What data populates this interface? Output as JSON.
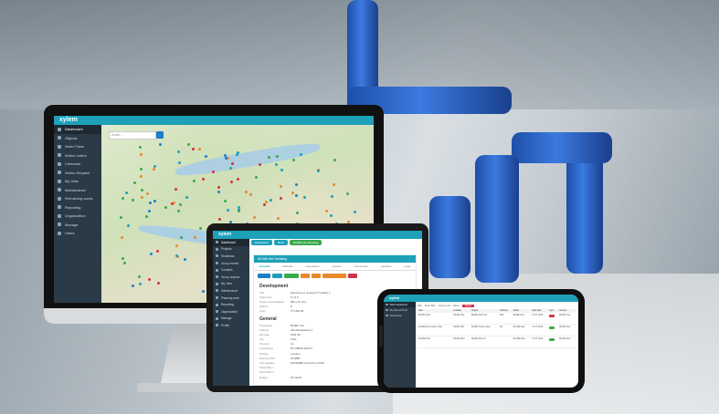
{
  "app": {
    "name": "xylem"
  },
  "colors": {
    "primary": "#1da0b8",
    "sidebar": "#2a3a46",
    "green": "#3aaa4c",
    "orange": "#e8892a",
    "red": "#d0314a"
  },
  "monitor": {
    "search_placeholder": "Zoek...",
    "sidebar": [
      "Dashboard",
      "Objects",
      "Work Flows",
      "Works orders",
      "Contracts",
      "Works Request",
      "My Jobs",
      "Maintenance",
      "Remaining works",
      "Reporting",
      "Organization",
      "Manage",
      "Users"
    ]
  },
  "tablet": {
    "breadcrumbs": [
      "Dashboard",
      "Mesh",
      "Bit-Blik Het Vertaling"
    ],
    "sidebar": [
      "Dashboard",
      "Projects",
      "Workflows",
      "Group events",
      "Contacts",
      "Group request",
      "My Jobs",
      "Maintenance",
      "Planning work",
      "Reporting",
      "Organization",
      "Manage",
      "Profile"
    ],
    "panel_title": "Bit-Blik Het Vertaling",
    "tabs": [
      "General",
      "Modules",
      "Inspections",
      "Actions",
      "Documents",
      "Activities",
      "Logs"
    ],
    "section_development": "Development",
    "dev_fields": [
      {
        "k": "UID",
        "v": "Gluerrena ex rectement Ti stellen ir"
      },
      {
        "k": "Initial code",
        "v": "5.1 5.5"
      },
      {
        "k": "Project Administration",
        "v": "Bitte anh Vorp"
      },
      {
        "k": "Method",
        "v": "8"
      },
      {
        "k": "Index",
        "v": "75 1305 08"
      }
    ],
    "section_general": "General",
    "gen_fields": [
      {
        "k": "Projecttype",
        "v": "Bit-Blik Tree"
      },
      {
        "k": "Address",
        "v": "Wid Mendeldress 3"
      },
      {
        "k": "Zip code",
        "v": "5402 SD"
      },
      {
        "k": "City",
        "v": "Putte"
      },
      {
        "k": "Province",
        "v": "GL"
      },
      {
        "k": "Coordinates",
        "v": "BX 188004 110071"
      },
      {
        "k": "Tellings",
        "v": "4 weken"
      },
      {
        "k": "Meeting PGP",
        "v": "25.0888"
      },
      {
        "k": "Unit selection",
        "v": "WATERBIP heeft 24 ex 29 B4"
      },
      {
        "k": "Owner/title 1",
        "v": ""
      },
      {
        "k": "Owner/title 2",
        "v": ""
      },
      {
        "k": "Budget",
        "v": "25.0 EUR"
      }
    ]
  },
  "phone": {
    "sidebar": [
      "Work request list",
      "My data work list",
      "Workorders"
    ],
    "toolbar": [
      "Add",
      "Show filter",
      "Column set",
      "Filters",
      "Reset"
    ],
    "columns": [
      "Nam",
      "Location",
      "Project",
      "Workers",
      "Status",
      "Start date",
      "Type",
      "Amount"
    ],
    "rows": [
      [
        "Bit-Blik 2015",
        "Bit-Blik Hoe",
        "Bit-Blik Nod 5:23",
        "Bit 8",
        "Bit-Blik Nod",
        "07-07-2019",
        "",
        "Bit-Blik Tree"
      ],
      [
        "Rol-Blik Riet Klasse 4016",
        "Bit-Blik Riet",
        "Bit-Blik Vraag Vullen",
        "Bit",
        "Rol-Blik Riet",
        "07-07-2019",
        "",
        "Bit-Blik Nod"
      ],
      [
        "Rol-Blik Plan",
        "Bit-Blik Plan",
        "Bit-Blik Plan-10",
        "",
        "Rol-Blik Plan",
        "07-07-2019",
        "",
        "Bit-Blik Plan"
      ]
    ]
  }
}
